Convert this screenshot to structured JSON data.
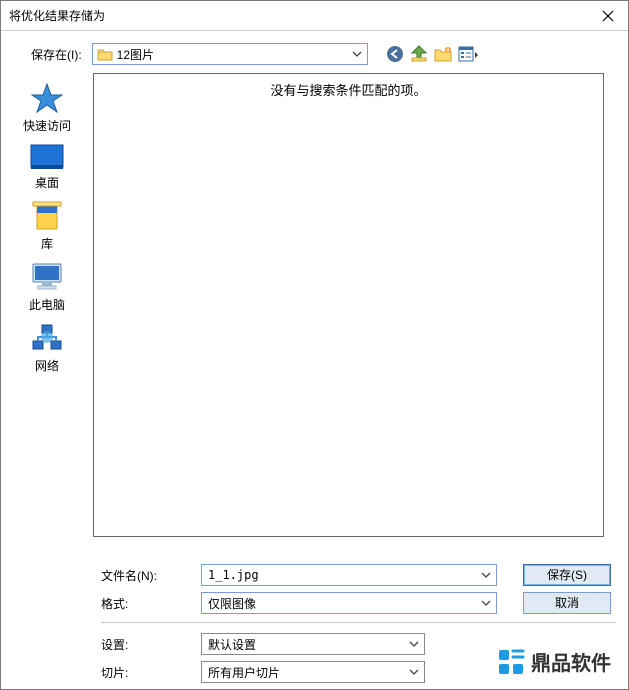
{
  "title": "将优化结果存储为",
  "save_in_label": "保存在(I):",
  "look_in_value": "12图片",
  "empty_message": "没有与搜索条件匹配的项。",
  "places": {
    "quick": "快速访问",
    "desktop": "桌面",
    "libraries": "库",
    "thispc": "此电脑",
    "network": "网络"
  },
  "fields": {
    "filename_label": "文件名(N):",
    "filename_value": "1_1.jpg",
    "format_label": "格式:",
    "format_value": "仅限图像",
    "settings_label": "设置:",
    "settings_value": "默认设置",
    "slices_label": "切片:",
    "slices_value": "所有用户切片"
  },
  "buttons": {
    "save": "保存(S)",
    "cancel": "取消"
  },
  "watermark": "鼎品软件"
}
